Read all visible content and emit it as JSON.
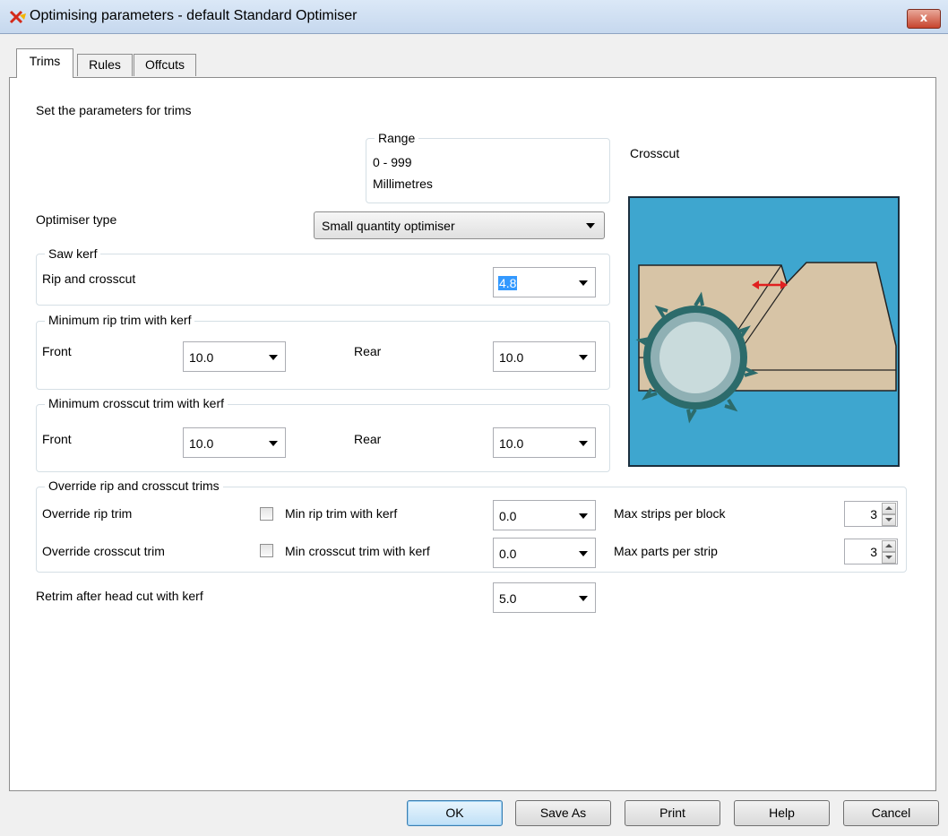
{
  "window": {
    "title": "Optimising parameters - default Standard Optimiser",
    "close_label": "x"
  },
  "tabs": [
    "Trims",
    "Rules",
    "Offcuts"
  ],
  "intro": "Set the parameters for trims",
  "range": {
    "legend": "Range",
    "value": "0 - 999",
    "units": "Millimetres"
  },
  "diagram": {
    "label": "Crosscut"
  },
  "optimiser_type": {
    "label": "Optimiser type",
    "value": "Small quantity optimiser"
  },
  "saw_kerf": {
    "legend": "Saw kerf",
    "label": "Rip and crosscut",
    "value": "4.8"
  },
  "min_rip": {
    "legend": "Minimum rip trim with kerf",
    "front_label": "Front",
    "front_value": "10.0",
    "rear_label": "Rear",
    "rear_value": "10.0"
  },
  "min_crosscut": {
    "legend": "Minimum crosscut trim with kerf",
    "front_label": "Front",
    "front_value": "10.0",
    "rear_label": "Rear",
    "rear_value": "10.0"
  },
  "override": {
    "legend": "Override rip and crosscut trims",
    "rip_label": "Override rip trim",
    "rip_check_label": "Min rip trim with kerf",
    "rip_value": "0.0",
    "max_strips_label": "Max strips per block",
    "max_strips_value": "3",
    "crosscut_label": "Override crosscut trim",
    "crosscut_check_label": "Min crosscut trim with kerf",
    "crosscut_value": "0.0",
    "max_parts_label": "Max parts per strip",
    "max_parts_value": "3"
  },
  "retrim": {
    "label": "Retrim after head cut with kerf",
    "value": "5.0"
  },
  "buttons": {
    "ok": "OK",
    "save_as": "Save As",
    "print": "Print",
    "help": "Help",
    "cancel": "Cancel"
  }
}
